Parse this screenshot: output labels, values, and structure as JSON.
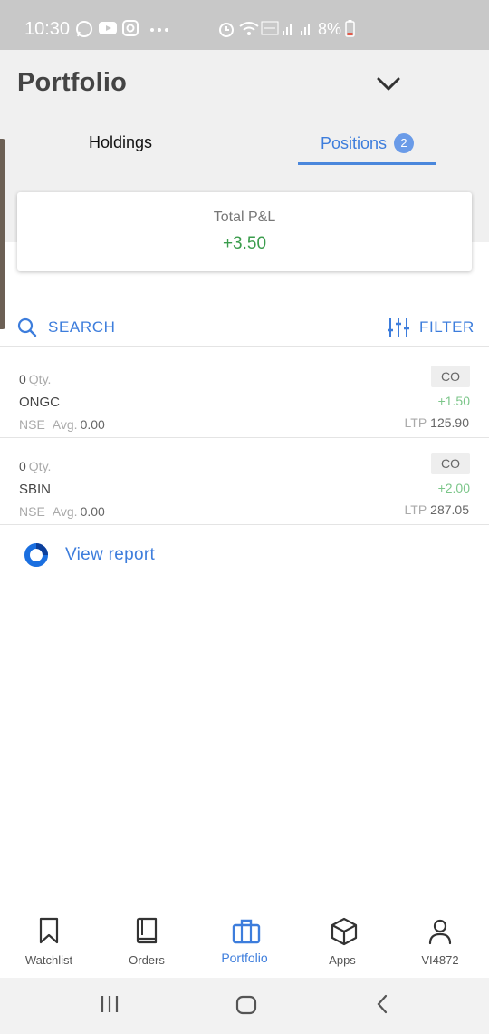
{
  "status_bar": {
    "time": "10:30",
    "battery": "8%",
    "icons": [
      "whatsapp-icon",
      "youtube-icon",
      "instagram-icon",
      "more-icon",
      "alarm-icon",
      "wifi-icon",
      "volte-icon",
      "signal-icon",
      "battery-icon"
    ]
  },
  "header": {
    "title": "Portfolio",
    "tabs": [
      {
        "label": "Holdings",
        "active": false
      },
      {
        "label": "Positions",
        "active": true,
        "badge": "2"
      }
    ],
    "accent_color": "#3d7ddc"
  },
  "pnl": {
    "label": "Total P&L",
    "value": "+3.50",
    "color": "#3a9c4c"
  },
  "toolbar": {
    "search_label": "SEARCH",
    "filter_label": "FILTER"
  },
  "positions": [
    {
      "qty": "0",
      "qty_unit": "Qty.",
      "symbol": "ONGC",
      "exchange": "NSE",
      "avg_label": "Avg.",
      "avg": "0.00",
      "product": "CO",
      "change": "+1.50",
      "ltp_label": "LTP",
      "ltp": "125.90"
    },
    {
      "qty": "0",
      "qty_unit": "Qty.",
      "symbol": "SBIN",
      "exchange": "NSE",
      "avg_label": "Avg.",
      "avg": "0.00",
      "product": "CO",
      "change": "+2.00",
      "ltp_label": "LTP",
      "ltp": "287.05"
    }
  ],
  "report": {
    "label": "View report"
  },
  "bottom_nav": [
    {
      "label": "Watchlist",
      "icon": "bookmark-icon"
    },
    {
      "label": "Orders",
      "icon": "book-icon"
    },
    {
      "label": "Portfolio",
      "icon": "briefcase-icon",
      "active": true
    },
    {
      "label": "Apps",
      "icon": "cube-icon"
    },
    {
      "label": "VI4872",
      "icon": "user-icon"
    }
  ]
}
